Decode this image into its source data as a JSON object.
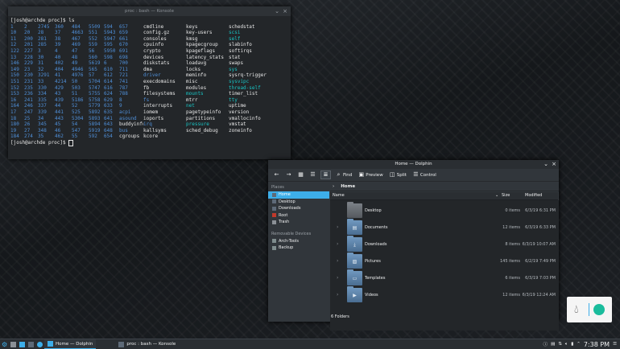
{
  "konsole": {
    "title": "proc : bash — Konsole",
    "prompt1": "[josh@archde proc]$ ls",
    "prompt2": "[josh@archde proc]$ ",
    "numbers": [
      [
        "1",
        "2",
        "2745",
        "360",
        "484",
        "5509",
        "594",
        "657"
      ],
      [
        "10",
        "20",
        "28",
        "37",
        "4663",
        "551",
        "5943",
        "659"
      ],
      [
        "11",
        "200",
        "281",
        "38",
        "467",
        "552",
        "5947",
        "661"
      ],
      [
        "12",
        "201",
        "285",
        "39",
        "469",
        "559",
        "595",
        "670"
      ],
      [
        "122",
        "227",
        "3",
        "4",
        "47",
        "56",
        "5950",
        "691"
      ],
      [
        "13",
        "228",
        "30",
        "40",
        "48",
        "560",
        "598",
        "698"
      ],
      [
        "146",
        "229",
        "31",
        "402",
        "49",
        "5619",
        "6",
        "700"
      ],
      [
        "149",
        "23",
        "32",
        "404",
        "4946",
        "565",
        "610",
        "711"
      ],
      [
        "150",
        "230",
        "3291",
        "41",
        "4976",
        "57",
        "612",
        "721"
      ],
      [
        "151",
        "231",
        "33",
        "4214",
        "50",
        "5704",
        "614",
        "741"
      ],
      [
        "152",
        "235",
        "330",
        "429",
        "503",
        "5747",
        "616",
        "787"
      ],
      [
        "153",
        "236",
        "334",
        "43",
        "51",
        "5755",
        "624",
        "788"
      ],
      [
        "16",
        "241",
        "335",
        "439",
        "5186",
        "5758",
        "629",
        "8"
      ],
      [
        "164",
        "246",
        "337",
        "44",
        "52",
        "5779",
        "633",
        "9"
      ],
      [
        "17",
        "247",
        "339",
        "441",
        "525",
        "5892",
        "635",
        "acpi"
      ],
      [
        "18",
        "25",
        "34",
        "443",
        "5304",
        "5893",
        "641",
        "asound"
      ],
      [
        "180",
        "26",
        "345",
        "45",
        "54",
        "5894",
        "643",
        "buddyinfo"
      ],
      [
        "19",
        "27",
        "348",
        "46",
        "547",
        "5919",
        "648",
        "bus"
      ],
      [
        "184",
        "274",
        "35",
        "462",
        "55",
        "592",
        "654",
        "cgroups"
      ]
    ],
    "colA": [
      "cmdline",
      "config.gz",
      "consoles",
      "cpuinfo",
      "crypto",
      "devices",
      "diskstats",
      "dma",
      "driver",
      "execdomains",
      "fb",
      "filesystems",
      "fs",
      "interrupts",
      "iomem",
      "ioports",
      "irq",
      "kallsyms",
      "kcore"
    ],
    "colB": [
      "keys",
      "key-users",
      "kmsg",
      "kpagecgroup",
      "kpageflags",
      "latency_stats",
      "loadavg",
      "locks",
      "meminfo",
      "misc",
      "modules",
      "mounts",
      "mtrr",
      "net",
      "pagetypeinfo",
      "partitions",
      "pressure",
      "sched_debug",
      ""
    ],
    "colC": [
      "schedstat",
      "scsi",
      "self",
      "slabinfo",
      "softirqs",
      "stat",
      "swaps",
      "sys",
      "sysrq-trigger",
      "sysvipc",
      "thread-self",
      "timer_list",
      "tty",
      "uptime",
      "version",
      "vmallocinfo",
      "vmstat",
      "zoneinfo",
      ""
    ]
  },
  "dolphin": {
    "title": "Home — Dolphin",
    "toolbar": {
      "find": "Find",
      "preview": "Preview",
      "split": "Split",
      "control": "Control"
    },
    "places_header": "Places",
    "places": [
      "Home",
      "Desktop",
      "Downloads",
      "Root",
      "Trash"
    ],
    "removable_header": "Removable Devices",
    "removable": [
      "Arch-Tools",
      "Backup"
    ],
    "breadcrumb": "Home",
    "columns": {
      "name": "Name",
      "size": "Size",
      "modified": "Modified"
    },
    "files": [
      {
        "name": "Desktop",
        "size": "0 items",
        "modified": "6/3/19 6:31 PM",
        "expand": false
      },
      {
        "name": "Documents",
        "size": "12 items",
        "modified": "6/3/19 6:33 PM",
        "expand": true
      },
      {
        "name": "Downloads",
        "size": "8 items",
        "modified": "6/3/19 10:07 AM",
        "expand": true
      },
      {
        "name": "Pictures",
        "size": "145 items",
        "modified": "6/2/19 7:49 PM",
        "expand": true
      },
      {
        "name": "Templates",
        "size": "6 items",
        "modified": "6/3/19 7:03 PM",
        "expand": true
      },
      {
        "name": "Videos",
        "size": "12 items",
        "modified": "6/3/19 12:24 AM",
        "expand": true
      }
    ],
    "status": "6 Folders"
  },
  "taskbar": {
    "tasks": [
      "Home — Dolphin",
      "proc : bash — Konsole"
    ],
    "clock": "7:38 PM"
  }
}
